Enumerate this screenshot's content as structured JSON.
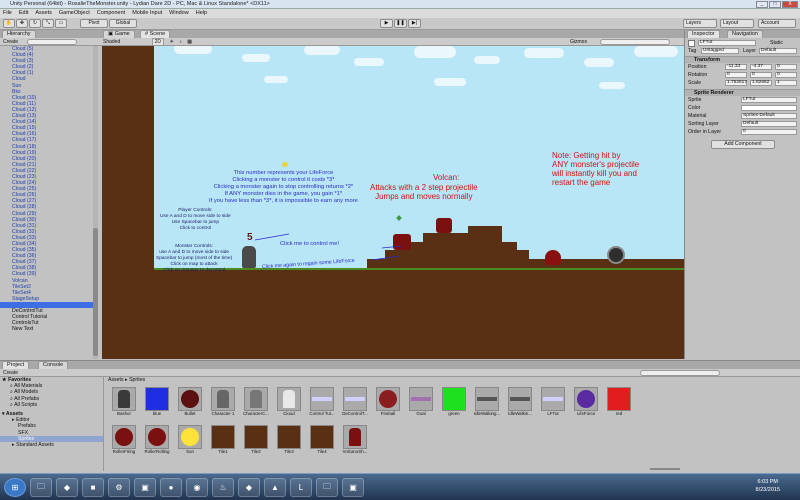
{
  "window": {
    "title": "Unity Personal (64bit) - RosalieTheMonster.unity - Lydian Dare 2D - PC, Mac & Linux Standalone* <DX11>",
    "controls": [
      "_",
      "□",
      "X"
    ]
  },
  "menu": [
    "File",
    "Edit",
    "Assets",
    "GameObject",
    "Component",
    "Mobile Input",
    "Window",
    "Help"
  ],
  "toolbar": {
    "pivot": "Pivot",
    "global": "Global",
    "play": "▶",
    "pause": "❚❚",
    "step": "▶|",
    "layers": "Layers",
    "layout": "Layout",
    "account": "Account"
  },
  "hierarchy": {
    "tab": "Hierarchy",
    "create": "Create",
    "search_placeholder": "All",
    "items": [
      "Cloud (5)",
      "Cloud (4)",
      "Cloud (3)",
      "Cloud (2)",
      "Cloud (1)",
      "Cloud",
      "Sun",
      "Bks",
      "Cloud (10)",
      "Cloud (11)",
      "Cloud (12)",
      "Cloud (13)",
      "Cloud (14)",
      "Cloud (15)",
      "Cloud (16)",
      "Cloud (17)",
      "Cloud (18)",
      "Cloud (19)",
      "Cloud (20)",
      "Cloud (21)",
      "Cloud (22)",
      "Cloud (23)",
      "Cloud (24)",
      "Cloud (25)",
      "Cloud (26)",
      "Cloud (27)",
      "Cloud (28)",
      "Cloud (29)",
      "Cloud (30)",
      "Cloud (31)",
      "Cloud (32)",
      "Cloud (33)",
      "Cloud (34)",
      "Cloud (35)",
      "Cloud (36)",
      "Cloud (37)",
      "Cloud (38)",
      "Cloud (39)",
      "Volcan",
      "TileSet2",
      "TileSet4",
      "StageSetup",
      "",
      "DeControlTut",
      "Control Tutorial",
      "ControlsTut",
      "New Text"
    ]
  },
  "scene": {
    "tabs": [
      "Game",
      "Scene"
    ],
    "shading": "Shaded",
    "mode2d": "2D",
    "gizmos": "Gizmos",
    "search_placeholder": "All",
    "lifeforce_note": "This number represents your LifeForce\nClicking a monster to control it costs *3*\nClicking a monster again to stop controlling returns *2*\nIf ANY monster dies in the game, you gain *1*\nIf you have less than *3*, it is impossible to earn any more",
    "lifeforce_number": "5",
    "player_controls": "Player Controls:\nUse A and D to move side to side\nUse Spacebar to jump\nClick to control",
    "monster_controls": "Monster Controls:\nuse A and D to move side to side\nSpacebar to jump (most of the time)\nClick on map to attack\nClick on monster to decontrol",
    "click_me": "Click me to control me!",
    "click_again": "Click me again to regain some LifeForce",
    "volcan_title": "Volcan:",
    "volcan_desc": "Attacks with a 2 step projectile\nJumps and moves normally",
    "warning_note": "Note: Getting hit by\nANY monster's projectile\nwill instantly kill you and\nrestart the game"
  },
  "inspector": {
    "tabs": [
      "Inspector",
      "Navigation"
    ],
    "object_name": "LFTut",
    "static_label": "Static",
    "tag_label": "Tag",
    "tag_value": "Untagged",
    "layer_label": "Layer",
    "layer_value": "Default",
    "transform": {
      "title": "Transform",
      "position": {
        "label": "Position",
        "x": "-11.33",
        "y": "-4.37",
        "z": "0"
      },
      "rotation": {
        "label": "Rotation",
        "x": "0",
        "y": "0",
        "z": "0"
      },
      "scale": {
        "label": "Scale",
        "x": "1.752817",
        "y": "1.82662",
        "z": "1"
      }
    },
    "sprite_renderer": {
      "title": "Sprite Renderer",
      "sprite": {
        "label": "Sprite",
        "value": "LFTut"
      },
      "color": {
        "label": "Color"
      },
      "material": {
        "label": "Material",
        "value": "Sprites-Default"
      },
      "sorting_layer": {
        "label": "Sorting Layer",
        "value": "Default"
      },
      "order_in_layer": {
        "label": "Order in Layer",
        "value": "0"
      }
    },
    "add_component": "Add Component"
  },
  "project": {
    "tabs": [
      "Project",
      "Console"
    ],
    "create": "Create",
    "favorites": {
      "title": "Favorites",
      "items": [
        "All Materials",
        "All Models",
        "All Prefabs",
        "All Scripts"
      ]
    },
    "assets_tree": {
      "title": "Assets",
      "items": [
        "Editor",
        "Prefabs",
        "SFX",
        "Sprites",
        "Standard Assets"
      ]
    },
    "breadcrumb": [
      "Assets",
      "Sprites"
    ],
    "assets": [
      {
        "name": "Bashor",
        "icon": "dark-monster",
        "color": "#3a3a3a"
      },
      {
        "name": "blue",
        "icon": "blue-square",
        "color": "#1f2ee0"
      },
      {
        "name": "Bullet",
        "icon": "dark-circle",
        "color": "#5c1010"
      },
      {
        "name": "Character 1",
        "icon": "character",
        "color": "#666666"
      },
      {
        "name": "CharacterC...",
        "icon": "character",
        "color": "#777777"
      },
      {
        "name": "Cloud",
        "icon": "cloud",
        "color": "#e8e8e8"
      },
      {
        "name": "Control Tut...",
        "icon": "text-strip",
        "color": "#d0d0ff"
      },
      {
        "name": "DeControlT...",
        "icon": "text-strip",
        "color": "#d0d0ff"
      },
      {
        "name": "Fireball",
        "icon": "fireball",
        "color": "#8a1e1e"
      },
      {
        "name": "Goal",
        "icon": "goal",
        "color": "#a070b0"
      },
      {
        "name": "green",
        "icon": "green-square",
        "color": "#1ee01e"
      },
      {
        "name": "IdleWalking...",
        "icon": "bar",
        "color": "#555555"
      },
      {
        "name": "IdleWalkin...",
        "icon": "bar",
        "color": "#555555"
      },
      {
        "name": "LFTut",
        "icon": "text-strip",
        "color": "#d0d0ff"
      },
      {
        "name": "LifeForce",
        "icon": "purple-circle",
        "color": "#5a2aa0"
      },
      {
        "name": "red",
        "icon": "red-square",
        "color": "#e01e1e"
      },
      {
        "name": "RollerFiring",
        "icon": "roller",
        "color": "#7a1010"
      },
      {
        "name": "RollerRolling",
        "icon": "roller",
        "color": "#7a1010"
      },
      {
        "name": "Sun",
        "icon": "sun",
        "color": "#ffe33a"
      },
      {
        "name": "Tile1",
        "icon": "tile",
        "color": "#5a3014"
      },
      {
        "name": "Tile2",
        "icon": "tile",
        "color": "#5a3014"
      },
      {
        "name": "Tile3",
        "icon": "tile",
        "color": "#5a3014"
      },
      {
        "name": "Tile4",
        "icon": "tile",
        "color": "#5a3014"
      },
      {
        "name": "VolcanoSh...",
        "icon": "volcan",
        "color": "#7a1010"
      }
    ]
  },
  "taskbar": {
    "time": "6:03 PM",
    "date": "8/23/2015",
    "apps": [
      "start-icon",
      "explorer-icon",
      "unity-icon",
      "minecraft-icon",
      "steam-icon",
      "photo-icon",
      "obs-icon",
      "chrome-icon",
      "flame-icon",
      "unity-alt-icon",
      "app-icon",
      "league-icon",
      "folder-icon",
      "app2-icon"
    ]
  }
}
